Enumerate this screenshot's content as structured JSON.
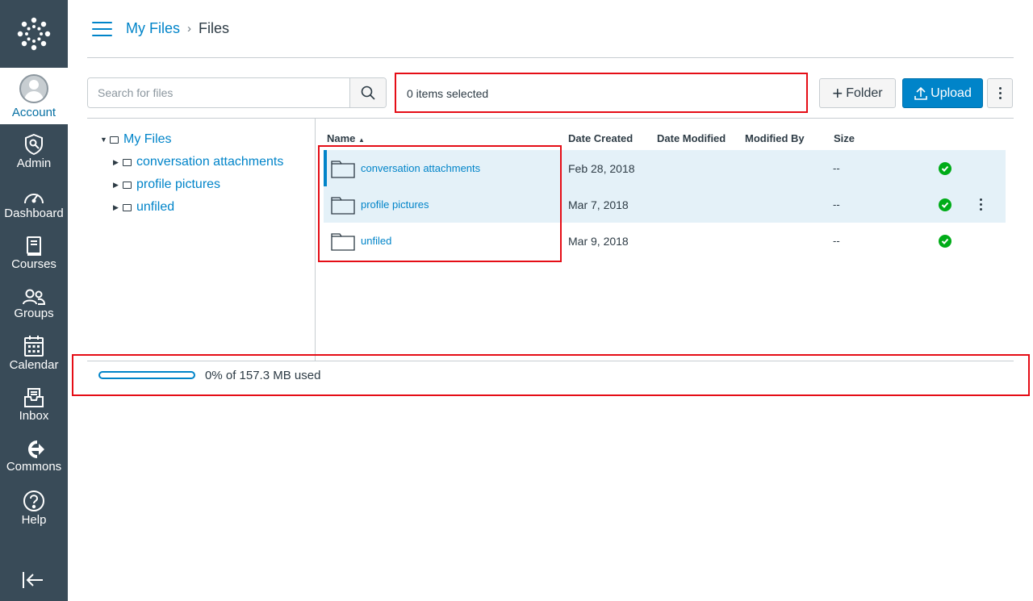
{
  "nav": {
    "account": "Account",
    "items": [
      {
        "label": "Admin",
        "icon": "admin-icon"
      },
      {
        "label": "Dashboard",
        "icon": "dashboard-icon"
      },
      {
        "label": "Courses",
        "icon": "courses-icon"
      },
      {
        "label": "Groups",
        "icon": "groups-icon"
      },
      {
        "label": "Calendar",
        "icon": "calendar-icon"
      },
      {
        "label": "Inbox",
        "icon": "inbox-icon"
      },
      {
        "label": "Commons",
        "icon": "commons-icon"
      },
      {
        "label": "Help",
        "icon": "help-icon"
      }
    ]
  },
  "header": {
    "breadcrumb_link": "My Files",
    "breadcrumb_current": "Files"
  },
  "toolbar": {
    "search_placeholder": "Search for files",
    "selected_text": "0 items selected",
    "folder_label": "Folder",
    "upload_label": "Upload"
  },
  "tree": {
    "root": "My Files",
    "folders": [
      "conversation attachments",
      "profile pictures",
      "unfiled"
    ]
  },
  "table": {
    "headers": {
      "name": "Name",
      "sort_indicator": "▲",
      "date_created": "Date Created",
      "date_modified": "Date Modified",
      "modified_by": "Modified By",
      "size": "Size"
    },
    "rows": [
      {
        "name": "conversation attachments",
        "created": "Feb 28, 2018",
        "modified": "",
        "modified_by": "",
        "size": "--",
        "published": true
      },
      {
        "name": "profile pictures",
        "created": "Mar 7, 2018",
        "modified": "",
        "modified_by": "",
        "size": "--",
        "published": true
      },
      {
        "name": "unfiled",
        "created": "Mar 9, 2018",
        "modified": "",
        "modified_by": "",
        "size": "--",
        "published": true
      }
    ]
  },
  "usage": {
    "text": "0% of 157.3 MB used",
    "fraction": 0
  },
  "colors": {
    "nav_bg": "#394b58",
    "accent": "#0084c9",
    "published": "#00ac18",
    "annotation": "#e50d16"
  }
}
